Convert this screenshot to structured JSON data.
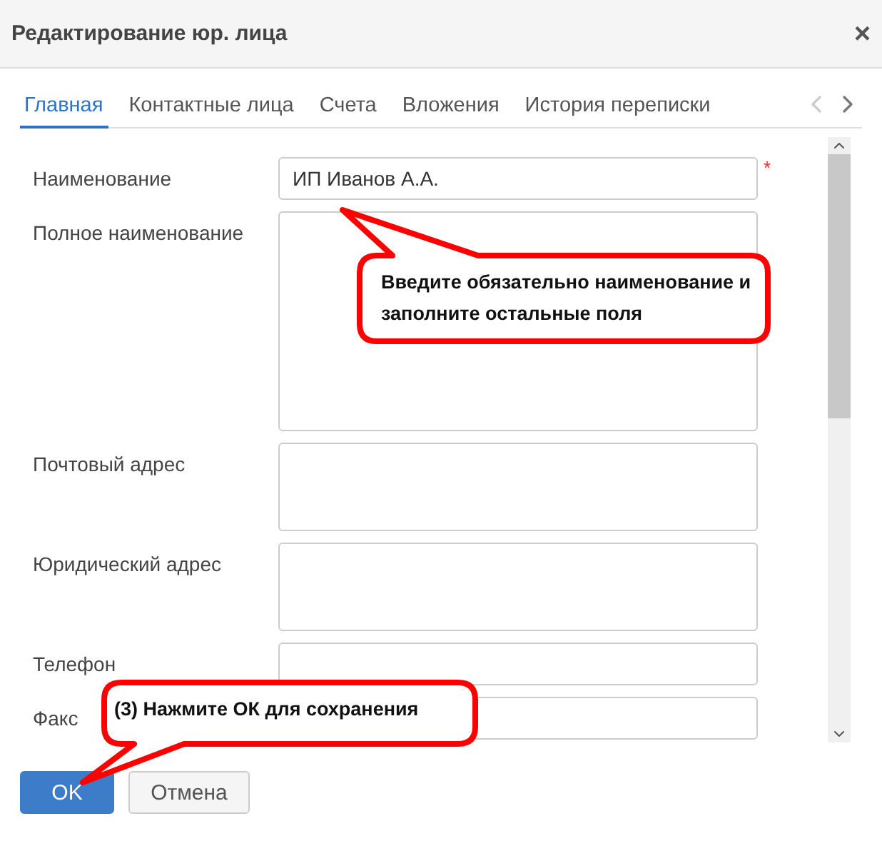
{
  "window": {
    "title": "Редактирование юр. лица",
    "close": "×"
  },
  "tabs": [
    {
      "label": "Главная",
      "selected": true
    },
    {
      "label": "Контактные лица",
      "selected": false
    },
    {
      "label": "Счета",
      "selected": false
    },
    {
      "label": "Вложения",
      "selected": false
    },
    {
      "label": "История переписки",
      "selected": false
    }
  ],
  "fields": [
    {
      "label": "Наименование",
      "kind": "input",
      "value": "ИП Иванов А.А.",
      "required_mark": "*"
    },
    {
      "label": "Полное наименование",
      "kind": "textarea"
    },
    {
      "label": "Почтовый адрес",
      "kind": "textarea"
    },
    {
      "label": "Юридический адрес",
      "kind": "textarea"
    },
    {
      "label": "Телефон",
      "kind": "input"
    },
    {
      "label": "Факс",
      "kind": "input"
    }
  ],
  "callouts": [
    {
      "text": "Введите обязательно наименование и заполните остальные поля"
    },
    {
      "text": "(3) Нажмите ОК для сохранения"
    }
  ],
  "buttons": [
    {
      "label": "OK",
      "kind": "primary"
    },
    {
      "label": "Отмена",
      "kind": "default"
    }
  ]
}
